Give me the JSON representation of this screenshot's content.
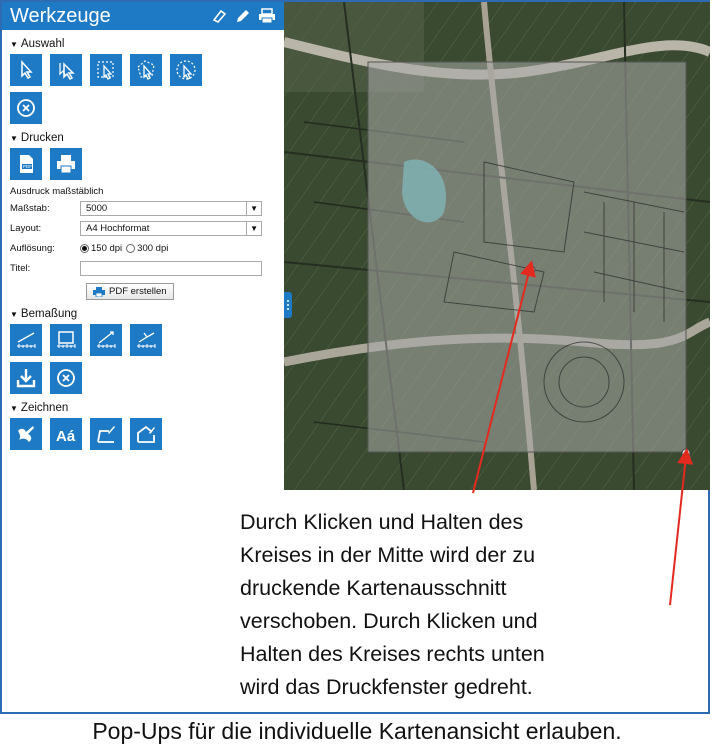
{
  "panel": {
    "title": "Werkzeuge",
    "header_icons": [
      "eraser-icon",
      "pencil-icon",
      "printer-icon"
    ]
  },
  "sections": {
    "auswahl": "Auswahl",
    "drucken": "Drucken",
    "bemassung": "Bemaßung",
    "zeichnen": "Zeichnen"
  },
  "auswahl_tools": [
    "select-pointer-icon",
    "select-multi-pointer-icon",
    "select-rectangle-icon",
    "select-polygon-icon",
    "select-circle-icon",
    "clear-selection-icon"
  ],
  "drucken_tools": [
    "pdf-icon",
    "print-icon"
  ],
  "print_form": {
    "heading": "Ausdruck maßstäblich",
    "scale_label": "Maßstab:",
    "scale_value": "5000",
    "layout_label": "Layout:",
    "layout_value": "A4 Hochformat",
    "resolution_label": "Auflösung:",
    "resolution_options": [
      "150 dpi",
      "300 dpi"
    ],
    "resolution_selected": "150 dpi",
    "title_label": "Titel:",
    "title_value": "",
    "pdf_button": "PDF erstellen"
  },
  "bemassung_tools": [
    "measure-distance-icon",
    "measure-area-icon",
    "measure-diagonal-icon",
    "measure-angle-icon",
    "download-icon",
    "clear-measure-icon"
  ],
  "zeichnen_tools": [
    "draw-point-icon",
    "draw-text-icon",
    "draw-line-icon",
    "draw-polygon-icon"
  ],
  "annotation_color": "#e32a1f",
  "accent_color": "#1e7ac4",
  "caption_lines": [
    "Durch Klicken und Halten des",
    "Kreises in der Mitte wird der zu",
    "druckende Kartenausschnitt",
    "verschoben. Durch Klicken und",
    "Halten des Kreises rechts unten",
    "wird das Druckfenster gedreht."
  ],
  "footer": "Pop-Ups für die individuelle Kartenansicht erlauben."
}
